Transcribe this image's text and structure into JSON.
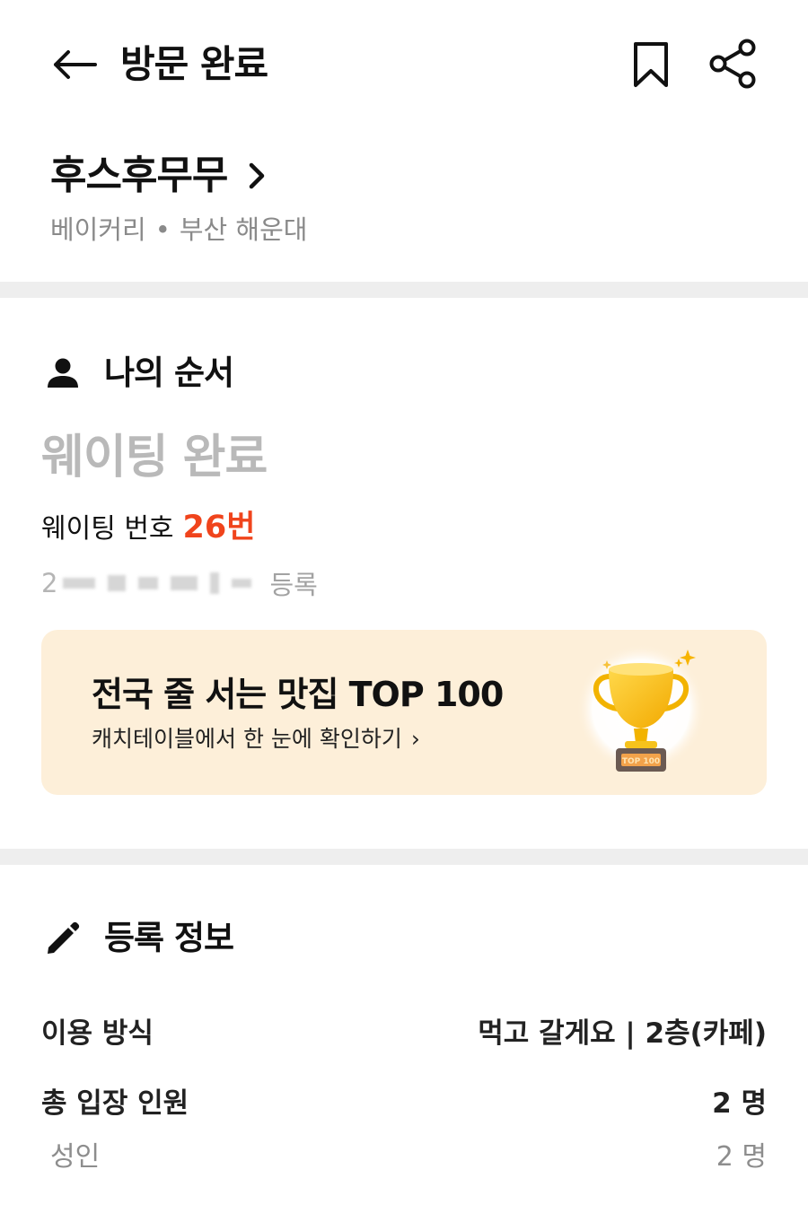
{
  "header": {
    "title": "방문 완료"
  },
  "store": {
    "name": "후스후무무",
    "category": "베이커리",
    "separator": "•",
    "location": "부산 해운대"
  },
  "my_order": {
    "section_title": "나의 순서",
    "status": "웨이팅 완료",
    "number_label": "웨이팅 번호",
    "number_value": "26번",
    "registered_prefix": "2",
    "registered_suffix": "등록"
  },
  "banner": {
    "title": "전국 줄 서는 맛집 TOP 100",
    "subtitle": "캐치테이블에서 한 눈에 확인하기",
    "chevron": "›",
    "trophy_plate_text": "TOP 100"
  },
  "registration": {
    "section_title": "등록 정보",
    "rows": [
      {
        "label": "이용 방식",
        "value": "먹고 갈게요 | 2층(카페)"
      },
      {
        "label": "총 입장 인원",
        "value": "2 명"
      },
      {
        "label": "성인",
        "value": "2 명"
      }
    ]
  },
  "colors": {
    "accent": "#f0441c",
    "banner_bg": "#fdefd9",
    "divider": "#eeeeee",
    "muted": "#8a8a8a"
  },
  "icons": {
    "back": "arrow-left-icon",
    "bookmark": "bookmark-icon",
    "share": "share-icon",
    "store_chevron": "chevron-right-icon",
    "person": "person-icon",
    "pencil": "pencil-icon",
    "trophy": "trophy-icon"
  }
}
